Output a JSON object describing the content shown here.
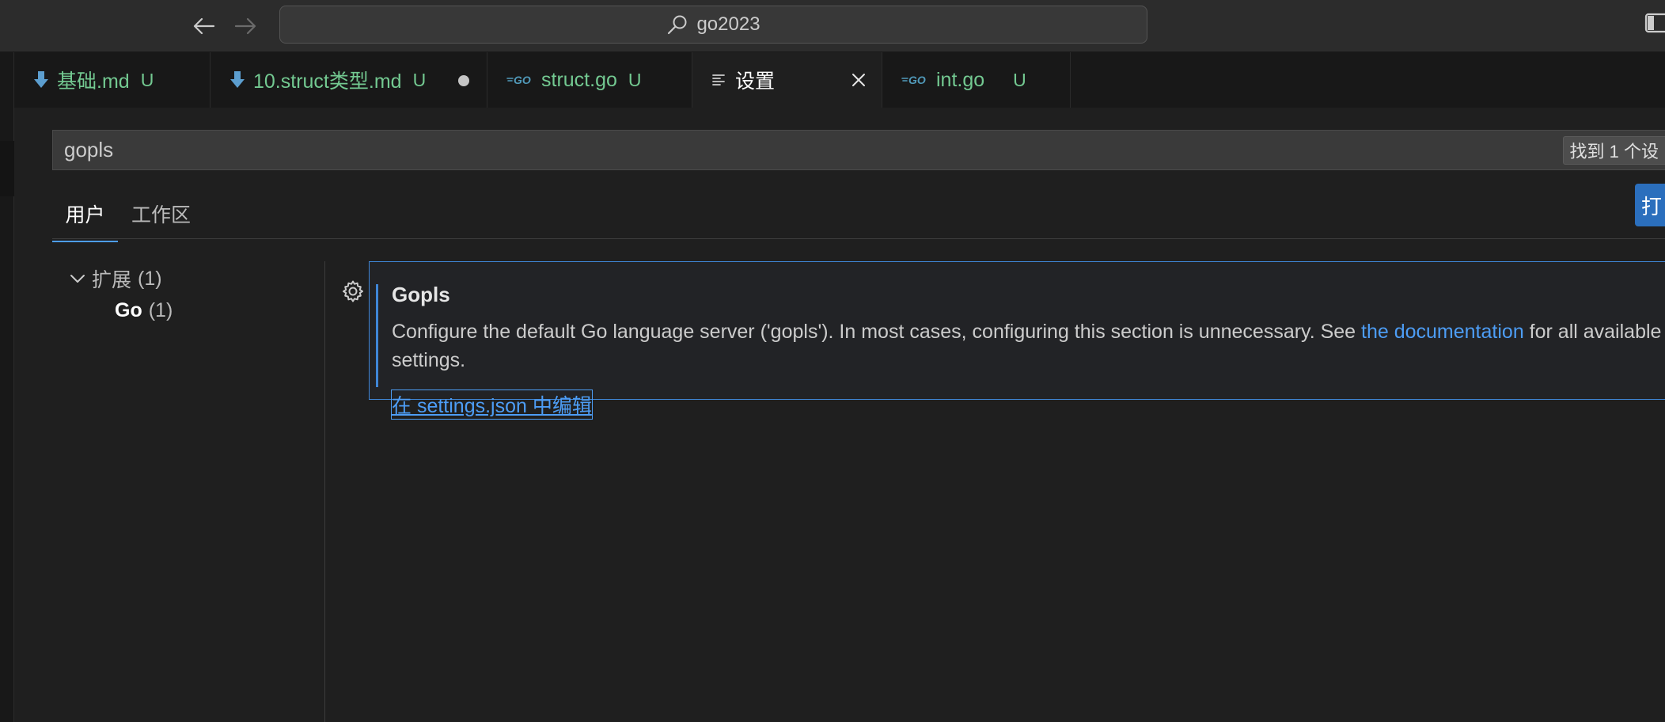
{
  "titlebar": {
    "search_text": "go2023",
    "icons": {
      "back": "arrow-left-icon",
      "forward": "arrow-right-icon",
      "search": "search-icon",
      "layout": "layout-sidebar-icon"
    }
  },
  "tabs": [
    {
      "label": "基础.md",
      "status": "U",
      "icon": "markdown-download-icon",
      "dirty": false,
      "active": false
    },
    {
      "label": "10.struct类型.md",
      "status": "U",
      "icon": "markdown-download-icon",
      "dirty": true,
      "active": false
    },
    {
      "label": "struct.go",
      "status": "U",
      "icon": "go-file-icon",
      "dirty": false,
      "active": false
    },
    {
      "label": "设置",
      "status": "",
      "icon": "settings-list-icon",
      "dirty": false,
      "active": true
    },
    {
      "label": "int.go",
      "status": "U",
      "icon": "go-file-icon",
      "dirty": false,
      "active": false
    }
  ],
  "settings": {
    "search_value": "gopls",
    "found_text": "找到 1 个设",
    "scopes": {
      "user": "用户",
      "workspace": "工作区"
    },
    "open_json_label": "打",
    "toc": {
      "extensions_label": "扩展",
      "extensions_count": "(1)",
      "go_label": "Go",
      "go_count": "(1)"
    },
    "item": {
      "title": "Gopls",
      "desc_before": "Configure the default Go language server ('gopls'). In most cases, configuring this section is unnecessary. See ",
      "desc_link": "the documentation",
      "desc_after": " for all available settings.",
      "edit_link": "在 settings.json 中编辑"
    }
  },
  "colors": {
    "accent_blue": "#4d9df5",
    "untracked_green": "#73c991",
    "background": "#1f1f1f"
  }
}
